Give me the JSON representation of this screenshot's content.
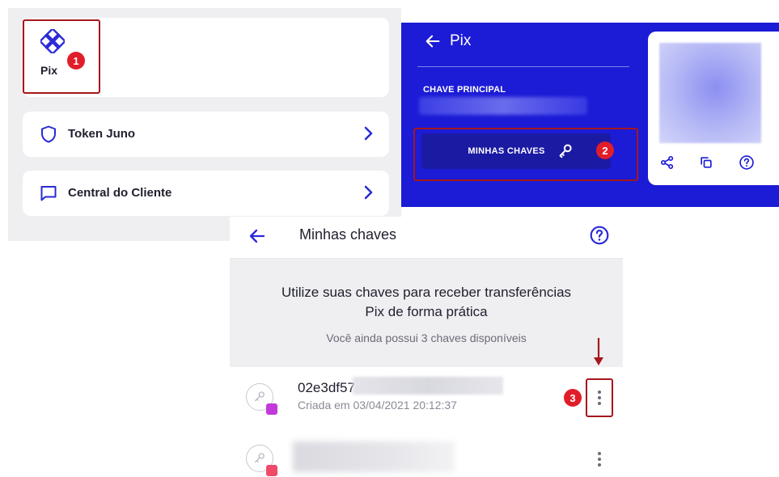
{
  "menu": {
    "pix_label": "Pix",
    "token_label": "Token Juno",
    "central_label": "Central do Cliente"
  },
  "pix_screen": {
    "title": "Pix",
    "chave_principal_label": "CHAVE PRINCIPAL",
    "minhas_chaves_button": "MINHAS CHAVES"
  },
  "keys_screen": {
    "title": "Minhas chaves",
    "info_line1": "Utilize suas chaves para receber transferências",
    "info_line2": "Pix de forma prática",
    "info_line3": "Você ainda possui 3 chaves disponíveis",
    "keys": [
      {
        "name": "02e3df57-",
        "created": "Criada em 03/04/2021 20:12:37"
      }
    ]
  },
  "steps": [
    "1",
    "2",
    "3"
  ],
  "colors": {
    "pix_blue": "#1c1bd6",
    "button_blue": "#1b1aa3",
    "icon_blue": "#2a2ad6",
    "highlight_red": "#a6171c",
    "badge_red": "#e11d2a"
  },
  "icons": {
    "pix": "pix-diamond-icon",
    "token": "shield-icon",
    "central": "chat-bubble-icon",
    "chevron": "chevron-right-icon",
    "back": "arrow-left-icon",
    "key": "key-icon",
    "share": "share-icon",
    "copy": "copy-icon",
    "help": "help-circle-icon",
    "more": "kebab-menu-icon"
  }
}
